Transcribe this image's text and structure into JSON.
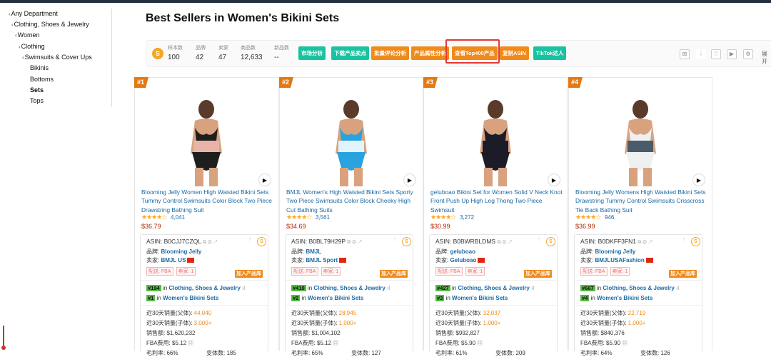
{
  "sidebar": {
    "items": [
      {
        "label": "Any Department",
        "chevron": true
      },
      {
        "label": "Clothing, Shoes & Jewelry",
        "chevron": true
      },
      {
        "label": "Women",
        "chevron": true
      },
      {
        "label": "Clothing",
        "chevron": true
      },
      {
        "label": "Swimsuits & Cover Ups",
        "chevron": true
      },
      {
        "label": "Bikinis",
        "chevron": false
      },
      {
        "label": "Bottoms",
        "chevron": false
      },
      {
        "label": "Sets",
        "chevron": false,
        "selected": true
      },
      {
        "label": "Tops",
        "chevron": false
      }
    ]
  },
  "page": {
    "title": "Best Sellers in Women's Bikini Sets"
  },
  "toolbar": {
    "logo": "S",
    "stats": [
      {
        "label": "样本数",
        "value": "100"
      },
      {
        "label": "品牌",
        "value": "42"
      },
      {
        "label": "卖家",
        "value": "47"
      },
      {
        "label": "商品数",
        "value": "12,633"
      },
      {
        "label": "新品数",
        "value": "--"
      }
    ],
    "buttons": [
      {
        "label": "市场分析",
        "color": "#19c2a0"
      },
      {
        "label": "下载产品卖点",
        "color": "#19c2a0"
      },
      {
        "label": "批量评论分析",
        "color": "#f08a1a"
      },
      {
        "label": "产品属性分析",
        "color": "#f08a1a"
      },
      {
        "label": "查看Top400产品",
        "color": "#f08a1a",
        "highlighted": true
      },
      {
        "label": "复制ASIN",
        "color": "#f08a1a"
      },
      {
        "label": "TikTok达人",
        "color": "#19c2a0"
      }
    ],
    "expand": "展开"
  },
  "labels": {
    "asin": "ASIN: ",
    "brand": "品牌: ",
    "seller": "卖家: ",
    "fulfillment": "配送: FBA",
    "seller_count": "卖家: 1",
    "add_to_library": "加入产品库",
    "in": "in",
    "sales_parent": "近30天销量(父体): ",
    "sales_child": "近30天销量(子体): ",
    "revenue": "销售额: ",
    "fba_fee": "FBA费用: ",
    "margin": "毛利率: ",
    "variants": "变体数: "
  },
  "products": [
    {
      "rank": "#1",
      "title": "Blooming Jelly Women High Waisted Bikini Sets Tummy Control Swimsuits Color Block Two Piece Drawstring Bathing Suit",
      "stars": "★★★★☆",
      "reviews": "4,041",
      "price": "$36.79",
      "asin": "B0CJJ7CZQL",
      "brand": "Blooming Jelly",
      "seller": "BMJL US",
      "rank_cat": "#194",
      "cat": "Clothing, Shoes & Jewelry",
      "rank_sub": "#1",
      "sub": "Women's Bikini Sets",
      "sales_parent": "44,040",
      "sales_child": "3,000+",
      "revenue": "$1,620,232",
      "fba": "$5.12",
      "margin": "66%",
      "variants": "185",
      "colors": [
        "#1e1e1e",
        "#e8b4a8"
      ]
    },
    {
      "rank": "#2",
      "title": "BMJL Women's High Waisted Bikini Sets Sporty Two Piece Swimsuits Color Block Cheeky High Cut Bathing Suits",
      "stars": "★★★★☆",
      "reviews": "3,561",
      "price": "$34.69",
      "asin": "B0BL79H29P",
      "brand": "BMJL",
      "seller": "BMJL Sport",
      "rank_cat": "#410",
      "cat": "Clothing, Shoes & Jewelry",
      "rank_sub": "#2",
      "sub": "Women's Bikini Sets",
      "sales_parent": "28,945",
      "sales_child": "1,000+",
      "revenue": "$1,004,102",
      "fba": "$5.12",
      "margin": "65%",
      "variants": "127",
      "colors": [
        "#29a3e0",
        "#e2f4fb"
      ]
    },
    {
      "rank": "#3",
      "title": "geluboao Bikini Set for Women Solid V Neck Knot Front Push Up High Leg Thong Two Piece Swimsuit",
      "stars": "★★★★☆",
      "reviews": "3,272",
      "price": "$30.99",
      "asin": "B0BWRBLDMS",
      "brand": "geluboao",
      "seller": "Geluboao",
      "rank_cat": "#427",
      "cat": "Clothing, Shoes & Jewelry",
      "rank_sub": "#3",
      "sub": "Women's Bikini Sets",
      "sales_parent": "32,037",
      "sales_child": "1,000+",
      "revenue": "$992,827",
      "fba": "$5.90",
      "margin": "61%",
      "variants": "209",
      "colors": [
        "#1c1c28",
        "#1c1c28"
      ]
    },
    {
      "rank": "#4",
      "title": "Blooming Jelly Womens High Waisted Bikini Sets Drawstring Tummy Control Swimsuits Crisscross Tie Back Bathing Suit",
      "stars": "★★★★☆",
      "reviews": "946",
      "price": "$36.99",
      "asin": "B0DKFF3FN1",
      "brand": "Blooming Jelly",
      "seller": "BMJLUSAFashion",
      "rank_cat": "#667",
      "cat": "Clothing, Shoes & Jewelry",
      "rank_sub": "#4",
      "sub": "Women's Bikini Sets",
      "sales_parent": "22,719",
      "sales_child": "1,000+",
      "revenue": "$840,376",
      "fba": "$5.90",
      "margin": "64%",
      "variants": "126",
      "colors": [
        "#eef0f2",
        "#4a5b6c"
      ]
    }
  ]
}
